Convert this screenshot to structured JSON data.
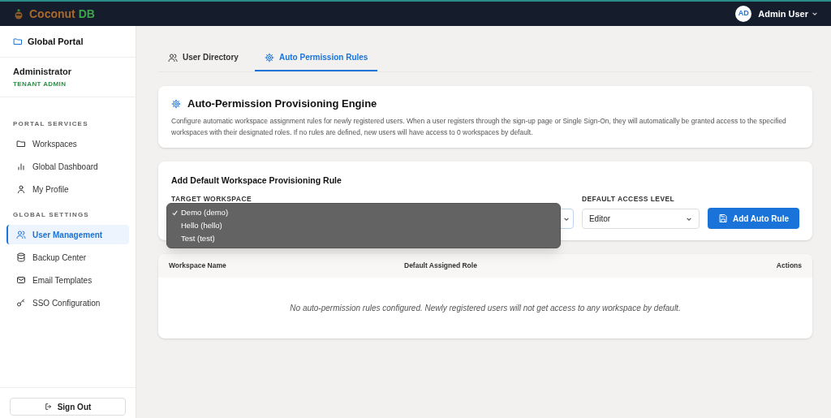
{
  "header": {
    "brand_part1": "Coconut",
    "brand_part2": "DB",
    "avatar": "AD",
    "user": "Admin User"
  },
  "sidebar": {
    "portal": "Global Portal",
    "role_name": "Administrator",
    "role_badge": "TENANT ADMIN",
    "sections": [
      {
        "title": "PORTAL SERVICES",
        "items": [
          {
            "label": "Workspaces",
            "selected": false
          },
          {
            "label": "Global Dashboard",
            "selected": false
          },
          {
            "label": "My Profile",
            "selected": false
          }
        ]
      },
      {
        "title": "GLOBAL SETTINGS",
        "items": [
          {
            "label": "User Management",
            "selected": true
          },
          {
            "label": "Backup Center",
            "selected": false
          },
          {
            "label": "Email Templates",
            "selected": false
          },
          {
            "label": "SSO Configuration",
            "selected": false
          }
        ]
      }
    ],
    "sign_out": "Sign Out"
  },
  "tabs": [
    {
      "label": "User Directory",
      "selected": false
    },
    {
      "label": "Auto Permission Rules",
      "selected": true
    }
  ],
  "intro": {
    "title": "Auto-Permission Provisioning Engine",
    "text": "Configure automatic workspace assignment rules for newly registered users. When a user registers through the sign-up page or Single Sign-On, they will automatically be granted access to the specified workspaces with their designated roles. If no rules are defined, new users will have access to 0 workspaces by default."
  },
  "form": {
    "title": "Add Default Workspace Provisioning Rule",
    "workspace_label": "TARGET WORKSPACE",
    "workspace_options": [
      {
        "label": "Demo (demo)",
        "selected": true
      },
      {
        "label": "Hello (hello)",
        "selected": false
      },
      {
        "label": "Test (test)",
        "selected": false
      }
    ],
    "access_label": "DEFAULT ACCESS LEVEL",
    "access_value": "Editor",
    "button": "Add Auto Rule"
  },
  "table": {
    "columns": [
      "Workspace Name",
      "Default Assigned Role",
      "Actions"
    ],
    "empty": "No auto-permission rules configured. Newly registered users will not get access to any workspace by default."
  }
}
